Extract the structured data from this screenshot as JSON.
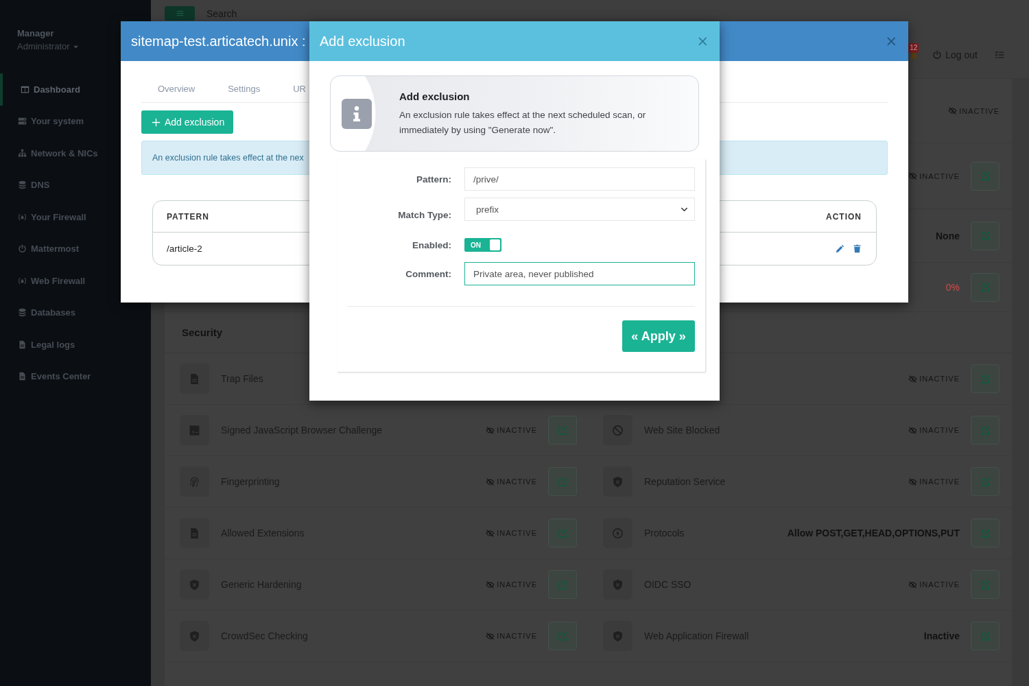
{
  "sidebar": {
    "user": {
      "name": "Manager",
      "role": "Administrator"
    },
    "items": [
      {
        "label": "Dashboard",
        "selected": true
      },
      {
        "label": "Your system",
        "selected": false
      },
      {
        "label": "Network & NICs",
        "selected": false
      },
      {
        "label": "DNS",
        "selected": false
      },
      {
        "label": "Your Firewall",
        "selected": false
      },
      {
        "label": "Mattermost",
        "selected": false
      },
      {
        "label": "Web Firewall",
        "selected": false
      },
      {
        "label": "Databases",
        "selected": false
      },
      {
        "label": "Legal logs",
        "selected": false
      },
      {
        "label": "Events Center",
        "selected": false
      }
    ]
  },
  "topbar": {
    "search": {
      "placeholder": "Search"
    },
    "notifications": {
      "count": "12"
    },
    "logout": "Log out"
  },
  "panel": {
    "status_rows": [
      {
        "status": {
          "kind": "flag",
          "text": "INACTIVE"
        },
        "edit_button": false
      },
      {
        "status": {
          "kind": "flag",
          "text": "INACTIVE"
        },
        "edit_button": true
      },
      {
        "status": {
          "kind": "value",
          "text": "None"
        },
        "edit_button": true
      },
      {
        "status": {
          "kind": "alert",
          "text": "0%"
        },
        "edit_button": true
      }
    ],
    "security": {
      "title": "Security",
      "columns": [
        {
          "rows": [
            {
              "name": "Trap Files",
              "edit_button": false
            },
            {
              "name": "Signed JavaScript Browser Challenge",
              "status": {
                "kind": "flag",
                "text": "INACTIVE"
              },
              "edit_button": true
            },
            {
              "name": "Fingerprinting",
              "status": {
                "kind": "flag",
                "text": "INACTIVE"
              },
              "edit_button": true
            },
            {
              "name": "Allowed Extensions",
              "status": {
                "kind": "flag",
                "text": "INACTIVE"
              },
              "edit_button": true
            },
            {
              "name": "Generic Hardening",
              "status": {
                "kind": "flag",
                "text": "INACTIVE"
              },
              "edit_button": true
            },
            {
              "name": "CrowdSec Checking",
              "status": {
                "kind": "flag",
                "text": "INACTIVE"
              },
              "edit_button": true
            }
          ]
        },
        {
          "rows": [
            {
              "status": {
                "kind": "flag",
                "text": "INACTIVE"
              },
              "edit_button": true
            },
            {
              "name": "Web Site Blocked",
              "status": {
                "kind": "flag",
                "text": "INACTIVE"
              },
              "edit_button": true
            },
            {
              "name": "Reputation Service",
              "status": {
                "kind": "flag",
                "text": "INACTIVE"
              },
              "edit_button": true
            },
            {
              "name": "Protocols",
              "status": {
                "kind": "value",
                "text": "Allow POST,GET,HEAD,OPTIONS,PUT"
              },
              "edit_button": true
            },
            {
              "name": "OIDC SSO",
              "status": {
                "kind": "flag",
                "text": "INACTIVE"
              },
              "edit_button": true
            },
            {
              "name": "Web Application Firewall",
              "status": {
                "kind": "value",
                "text": "Inactive"
              },
              "edit_button": true
            }
          ]
        }
      ]
    }
  },
  "modal1": {
    "title": "sitemap-test.articatech.unix :",
    "close": "×",
    "tabs": [
      {
        "label": "Overview",
        "selected": false
      },
      {
        "label": "Settings",
        "selected": false
      },
      {
        "label": "UR",
        "selected": false
      }
    ],
    "add_button": "Add exclusion",
    "alert": "An exclusion rule takes effect at the nex",
    "table": {
      "columns": [
        "PATTERN",
        "ACTION"
      ],
      "rows": [
        {
          "pattern": "/article-2"
        }
      ]
    }
  },
  "modal2": {
    "title": "Add exclusion",
    "close": "×",
    "info": {
      "title": "Add exclusion",
      "text": "An exclusion rule takes effect at the next scheduled scan, or immediately by using \"Generate now\"."
    },
    "form": {
      "fields": [
        {
          "kind": "text",
          "label": "Pattern:",
          "value": "/prive/",
          "focused": false
        },
        {
          "kind": "select",
          "label": "Match Type:",
          "value": "prefix"
        },
        {
          "kind": "toggle",
          "label": "Enabled:",
          "on": true,
          "text": "ON"
        },
        {
          "kind": "text",
          "label": "Comment:",
          "value": "Private area, never published",
          "focused": true
        }
      ]
    },
    "apply_button": "« Apply »"
  }
}
